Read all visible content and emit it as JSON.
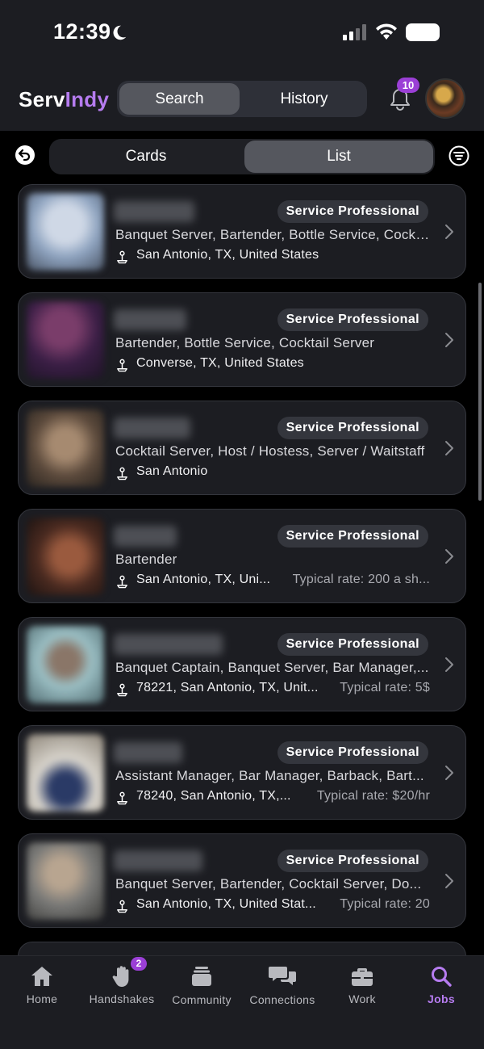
{
  "status_bar": {
    "time": "12:39"
  },
  "header": {
    "logo_serv": "Serv",
    "logo_indy": "Indy",
    "tabs": {
      "search": "Search",
      "history": "History"
    },
    "notification_count": "10"
  },
  "view_toggle": {
    "cards": "Cards",
    "list": "List"
  },
  "badge_label": "Service Professional",
  "cards": [
    {
      "roles": "Banquet Server, Bartender, Bottle Service, Cocktail Server",
      "location": "San Antonio, TX, United States",
      "rate": ""
    },
    {
      "roles": "Bartender, Bottle Service, Cocktail Server",
      "location": "Converse, TX, United States",
      "rate": ""
    },
    {
      "roles": "Cocktail Server, Host / Hostess, Server / Waitstaff",
      "location": "San Antonio",
      "rate": ""
    },
    {
      "roles": "Bartender",
      "location": "San Antonio, TX, Uni...",
      "rate": "Typical rate: 200 a sh..."
    },
    {
      "roles": "Banquet Captain, Banquet Server, Bar Manager,...",
      "location": "78221, San Antonio, TX, Unit...",
      "rate": "Typical rate: 5$"
    },
    {
      "roles": "Assistant Manager, Bar Manager, Barback, Bart...",
      "location": "78240, San Antonio, TX,...",
      "rate": "Typical rate: $20/hr"
    },
    {
      "roles": "Banquet Server, Bartender, Cocktail Server, Do...",
      "location": "San Antonio, TX, United Stat...",
      "rate": "Typical rate: 20"
    }
  ],
  "tabbar": {
    "home": "Home",
    "handshakes": "Handshakes",
    "handshakes_badge": "2",
    "community": "Community",
    "connections": "Connections",
    "work": "Work",
    "jobs": "Jobs"
  },
  "colors": {
    "accent": "#b67cf0",
    "badge": "#9b3fd6",
    "card_bg": "#1c1d22"
  }
}
